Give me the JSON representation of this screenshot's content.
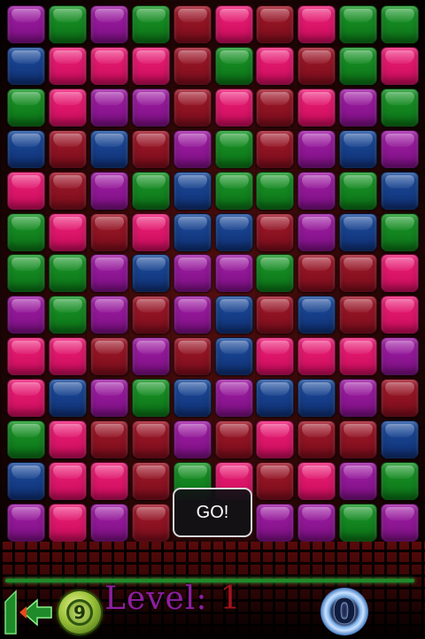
{
  "colors": {
    "purple": "#a31fa8",
    "green": "#1c9a2a",
    "blue": "#1e4fa0",
    "crimson": "#a3192b",
    "pink": "#f0207a",
    "hud_line": "#1e8a2a",
    "level_text": "#8d1fa0",
    "level_number": "#a3131e"
  },
  "board": {
    "columns": 10,
    "rows": 13,
    "grid": [
      [
        "purple",
        "green",
        "purple",
        "green",
        "crimson",
        "pink",
        "crimson",
        "pink",
        "green",
        "green"
      ],
      [
        "blue",
        "pink",
        "pink",
        "pink",
        "crimson",
        "green",
        "pink",
        "crimson",
        "green",
        "pink"
      ],
      [
        "green",
        "pink",
        "purple",
        "purple",
        "crimson",
        "pink",
        "crimson",
        "pink",
        "purple",
        "green"
      ],
      [
        "blue",
        "crimson",
        "blue",
        "crimson",
        "purple",
        "green",
        "crimson",
        "purple",
        "blue",
        "purple"
      ],
      [
        "pink",
        "crimson",
        "purple",
        "green",
        "blue",
        "green",
        "green",
        "purple",
        "green",
        "blue"
      ],
      [
        "green",
        "pink",
        "crimson",
        "pink",
        "blue",
        "blue",
        "crimson",
        "purple",
        "blue",
        "green"
      ],
      [
        "green",
        "green",
        "purple",
        "blue",
        "purple",
        "purple",
        "green",
        "crimson",
        "crimson",
        "pink"
      ],
      [
        "purple",
        "green",
        "purple",
        "crimson",
        "purple",
        "blue",
        "crimson",
        "blue",
        "crimson",
        "pink"
      ],
      [
        "pink",
        "pink",
        "crimson",
        "purple",
        "crimson",
        "blue",
        "pink",
        "pink",
        "pink",
        "purple"
      ],
      [
        "pink",
        "blue",
        "purple",
        "green",
        "blue",
        "purple",
        "blue",
        "blue",
        "purple",
        "crimson"
      ],
      [
        "green",
        "pink",
        "crimson",
        "crimson",
        "purple",
        "crimson",
        "pink",
        "crimson",
        "crimson",
        "blue"
      ],
      [
        "blue",
        "pink",
        "pink",
        "crimson",
        "green",
        "pink",
        "crimson",
        "pink",
        "purple",
        "green"
      ],
      [
        "purple",
        "pink",
        "purple",
        "crimson",
        "",
        null,
        "purple",
        "purple",
        "green",
        "purple"
      ]
    ]
  },
  "overlay": {
    "go_label": "GO!"
  },
  "hud": {
    "back_icon": "back-arrow-icon",
    "shuffle_icon": "shuffle-badge-icon",
    "shuffle_count": "9",
    "level_label": "Level:",
    "level_value": "1",
    "score_value": "0"
  }
}
